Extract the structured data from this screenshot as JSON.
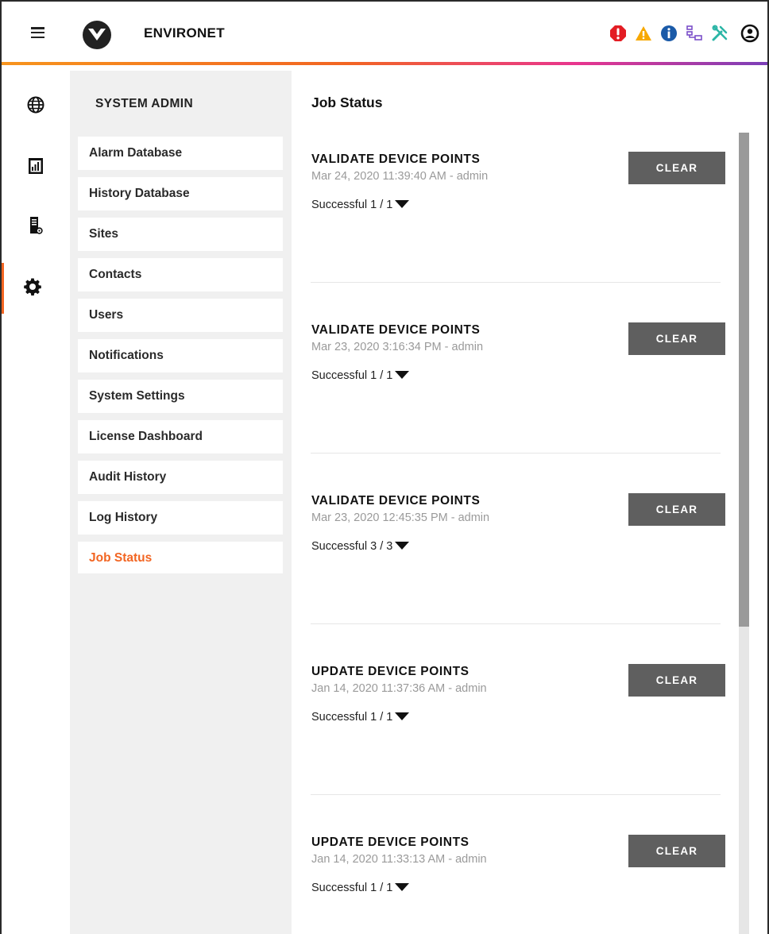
{
  "header": {
    "brand": "ENVIRONET",
    "icons": [
      "menu-icon",
      "vertiv-logo",
      "critical-alarm-icon",
      "warning-icon",
      "info-icon",
      "network-icon",
      "tools-icon",
      "user-account-icon"
    ],
    "colors": {
      "critical": "#e31d24",
      "warning": "#f7a800",
      "info": "#1a5aa8",
      "network": "#7b4fc9",
      "tools": "#2bb5a6",
      "accent": "#f26522"
    }
  },
  "rail": {
    "items": [
      {
        "icon": "globe-icon"
      },
      {
        "icon": "reports-icon"
      },
      {
        "icon": "devices-icon"
      },
      {
        "icon": "gear-icon",
        "active": true
      }
    ]
  },
  "subnav": {
    "title": "SYSTEM ADMIN",
    "items": [
      {
        "label": "Alarm Database"
      },
      {
        "label": "History Database"
      },
      {
        "label": "Sites"
      },
      {
        "label": "Contacts"
      },
      {
        "label": "Users"
      },
      {
        "label": "Notifications"
      },
      {
        "label": "System Settings"
      },
      {
        "label": "License Dashboard"
      },
      {
        "label": "Audit History"
      },
      {
        "label": "Log History"
      },
      {
        "label": "Job Status",
        "active": true
      }
    ]
  },
  "main": {
    "title": "Job Status",
    "clear_label": "CLEAR",
    "jobs": [
      {
        "name": "VALIDATE DEVICE POINTS",
        "meta": "Mar 24, 2020 11:39:40 AM - admin",
        "status": "Successful 1 / 1"
      },
      {
        "name": "VALIDATE DEVICE POINTS",
        "meta": "Mar 23, 2020 3:16:34 PM - admin",
        "status": "Successful 1 / 1"
      },
      {
        "name": "VALIDATE DEVICE POINTS",
        "meta": "Mar 23, 2020 12:45:35 PM - admin",
        "status": "Successful 3 / 3"
      },
      {
        "name": "UPDATE DEVICE POINTS",
        "meta": "Jan 14, 2020 11:37:36 AM - admin",
        "status": "Successful 1 / 1"
      },
      {
        "name": "UPDATE DEVICE POINTS",
        "meta": "Jan 14, 2020 11:33:13 AM - admin",
        "status": "Successful 1 / 1"
      }
    ]
  }
}
